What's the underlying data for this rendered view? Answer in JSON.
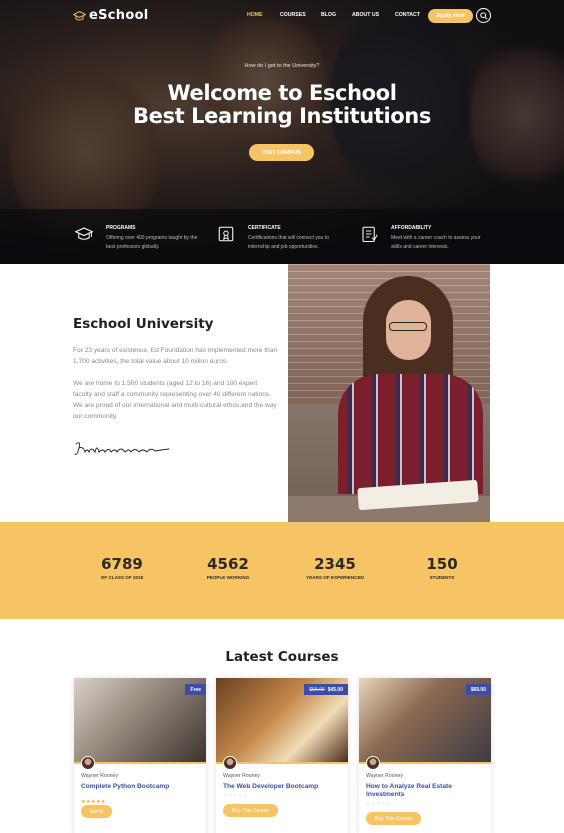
{
  "brand": {
    "name": "eSchool",
    "accent": "#f7c465",
    "dark": "#222222",
    "link": "#3b4ea5"
  },
  "nav": {
    "items": [
      {
        "label": "HOME",
        "active": true
      },
      {
        "label": "COURSES",
        "active": false
      },
      {
        "label": "BLOG",
        "active": false
      },
      {
        "label": "ABOUT US",
        "active": false
      },
      {
        "label": "CONTACT",
        "active": false
      }
    ],
    "apply_label": "Apply Now",
    "search_icon": "search-icon"
  },
  "hero": {
    "subtitle": "How do I get to the University?",
    "title_line1": "Welcome to Eschool",
    "title_line2": "Best Learning Institutions",
    "cta_label": "VISIT CAMPUS"
  },
  "features": [
    {
      "icon": "graduation-cap-icon",
      "title": "PROGRAMS",
      "text": "Offering over 400 programs taught by the best professors globally."
    },
    {
      "icon": "certificate-icon",
      "title": "CERTIFICATE",
      "text": "Certifications that will connect you to internship and job opportunities."
    },
    {
      "icon": "checklist-icon",
      "title": "AFFORDABILITY",
      "text": "Meet with a career coach to assess your skills and career interests."
    }
  ],
  "about": {
    "title": "Eschool University",
    "p1": "For 23 years of existence, Ed Foundation has implemented more than 1,700 activities, the total value about 10 milion euros.",
    "p2": "We are home to 1,500 students (aged 12 to 16) and 100 expert faculty and staff a community representing over 40 different nations. We are proud of our international and multi-cultural ethos,and the way our community."
  },
  "stats": [
    {
      "value": "6789",
      "label": "OF CLASS OF 2018"
    },
    {
      "value": "4562",
      "label": "PEOPLE WORKING"
    },
    {
      "value": "2345",
      "label": "YEARS OF EXPERIENCEN"
    },
    {
      "value": "150",
      "label": "STUDENTS"
    }
  ],
  "courses": {
    "title": "Latest Courses",
    "items": [
      {
        "price": "Free",
        "old_price": "",
        "author": "Wayner Rooney",
        "title": "Complete Python Bootcamp",
        "button": "Enroll",
        "rating": 5
      },
      {
        "price": "$45.00",
        "old_price": "$55.00",
        "author": "Wayner Rooney",
        "title": "The Web Developer Bootcamp",
        "button": "Buy This Course",
        "rating": 0
      },
      {
        "price": "$69.00",
        "old_price": "",
        "author": "Wayner Rooney",
        "title": "How to Analyze Real Estate Investments",
        "button": "Buy This Course",
        "rating": 0
      }
    ]
  }
}
